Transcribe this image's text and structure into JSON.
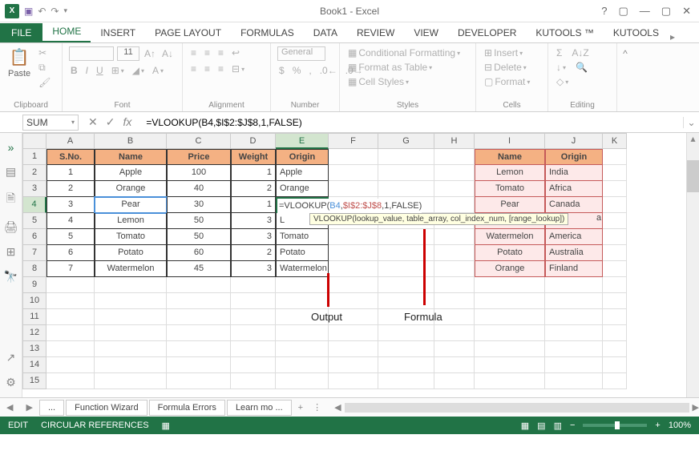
{
  "app_title": "Book1 - Excel",
  "tabs": {
    "file": "FILE",
    "list": [
      "HOME",
      "INSERT",
      "PAGE LAYOUT",
      "FORMULAS",
      "DATA",
      "REVIEW",
      "VIEW",
      "DEVELOPER",
      "KUTOOLS ™",
      "KUTOOLS"
    ],
    "active": "HOME"
  },
  "ribbon": {
    "clipboard": {
      "label": "Clipboard",
      "paste": "Paste"
    },
    "font": {
      "label": "Font",
      "name": "",
      "size": "11",
      "bold": "B",
      "italic": "I",
      "underline": "U"
    },
    "alignment": {
      "label": "Alignment"
    },
    "number": {
      "label": "Number",
      "format": "General",
      "currency": "$",
      "percent": "%",
      "comma": ","
    },
    "styles": {
      "label": "Styles",
      "cf": "Conditional Formatting",
      "fat": "Format as Table",
      "cs": "Cell Styles"
    },
    "cells": {
      "label": "Cells",
      "insert": "Insert",
      "delete": "Delete",
      "format": "Format"
    },
    "editing": {
      "label": "Editing",
      "sum": "Σ",
      "sort": "A↓Z"
    }
  },
  "formula_bar": {
    "namebox": "SUM",
    "formula": "=VLOOKUP(B4,$I$2:$J$8,1,FALSE)"
  },
  "columns": [
    "A",
    "B",
    "C",
    "D",
    "E",
    "F",
    "G",
    "H",
    "I",
    "J",
    "K"
  ],
  "main_table": {
    "headers": [
      "S.No.",
      "Name",
      "Price",
      "Weight",
      "Origin"
    ],
    "rows": [
      {
        "sno": "1",
        "name": "Apple",
        "price": "100",
        "weight": "1",
        "origin": "Apple"
      },
      {
        "sno": "2",
        "name": "Orange",
        "price": "40",
        "weight": "2",
        "origin": "Orange"
      },
      {
        "sno": "3",
        "name": "Pear",
        "price": "30",
        "weight": "1",
        "origin": "=VLOOKUP(B4,$I$2:$J$8,1,FALSE)"
      },
      {
        "sno": "4",
        "name": "Lemon",
        "price": "50",
        "weight": "3",
        "origin": "L"
      },
      {
        "sno": "5",
        "name": "Tomato",
        "price": "50",
        "weight": "3",
        "origin": "Tomato"
      },
      {
        "sno": "6",
        "name": "Potato",
        "price": "60",
        "weight": "2",
        "origin": "Potato"
      },
      {
        "sno": "7",
        "name": "Watermelon",
        "price": "45",
        "weight": "3",
        "origin": "Watermelon"
      }
    ]
  },
  "lookup_table": {
    "headers": [
      "Name",
      "Origin"
    ],
    "rows": [
      {
        "name": "Lemon",
        "origin": "India"
      },
      {
        "name": "Tomato",
        "origin": "Africa"
      },
      {
        "name": "Pear",
        "origin": "Canada"
      },
      {
        "name": "",
        "origin": ""
      },
      {
        "name": "Watermelon",
        "origin": "America"
      },
      {
        "name": "Potato",
        "origin": "Australia"
      },
      {
        "name": "Orange",
        "origin": "Finland"
      }
    ]
  },
  "tooltip": "VLOOKUP(lookup_value, table_array, col_index_num, [range_lookup])",
  "tooltip_trail": "a",
  "formula_parts": {
    "p1": "=VLOOKUP(",
    "p2": "B4",
    "p3": ",",
    "p4": "$I$2:$J$8",
    "p5": ",1,FALSE)"
  },
  "callouts": {
    "output": "Output",
    "formula": "Formula"
  },
  "sheet_tabs": {
    "t1": "...",
    "t2": "Function Wizard",
    "t3": "Formula Errors",
    "t4": "Learn mo ...",
    "plus": "+"
  },
  "statusbar": {
    "mode": "EDIT",
    "circ": "CIRCULAR REFERENCES",
    "zoom": "100%"
  }
}
